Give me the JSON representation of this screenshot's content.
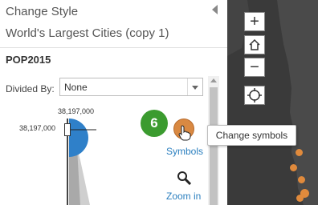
{
  "panel": {
    "title": "Change Style",
    "layer_name": "World's Largest Cities (copy 1)",
    "field": "POP2015",
    "divided_by_label": "Divided By:",
    "divided_by_value": "None"
  },
  "slider": {
    "top_value": "38,197,000",
    "handle_value": "38,197,000"
  },
  "callout": {
    "step": "6"
  },
  "actions": {
    "symbols_label": "Symbols",
    "zoom_label": "Zoom in"
  },
  "tooltip": {
    "text": "Change symbols"
  },
  "map_controls": {
    "zoom_in": "+",
    "zoom_out": "−"
  },
  "colors": {
    "badge": "#3b9b2f",
    "symbol": "#d98942",
    "link": "#2b7fbf",
    "map_bg": "#3a3a3a"
  },
  "icons": [
    "collapse-arrow-icon",
    "home-icon",
    "locate-icon",
    "magnifier-icon",
    "hand-cursor-icon"
  ]
}
